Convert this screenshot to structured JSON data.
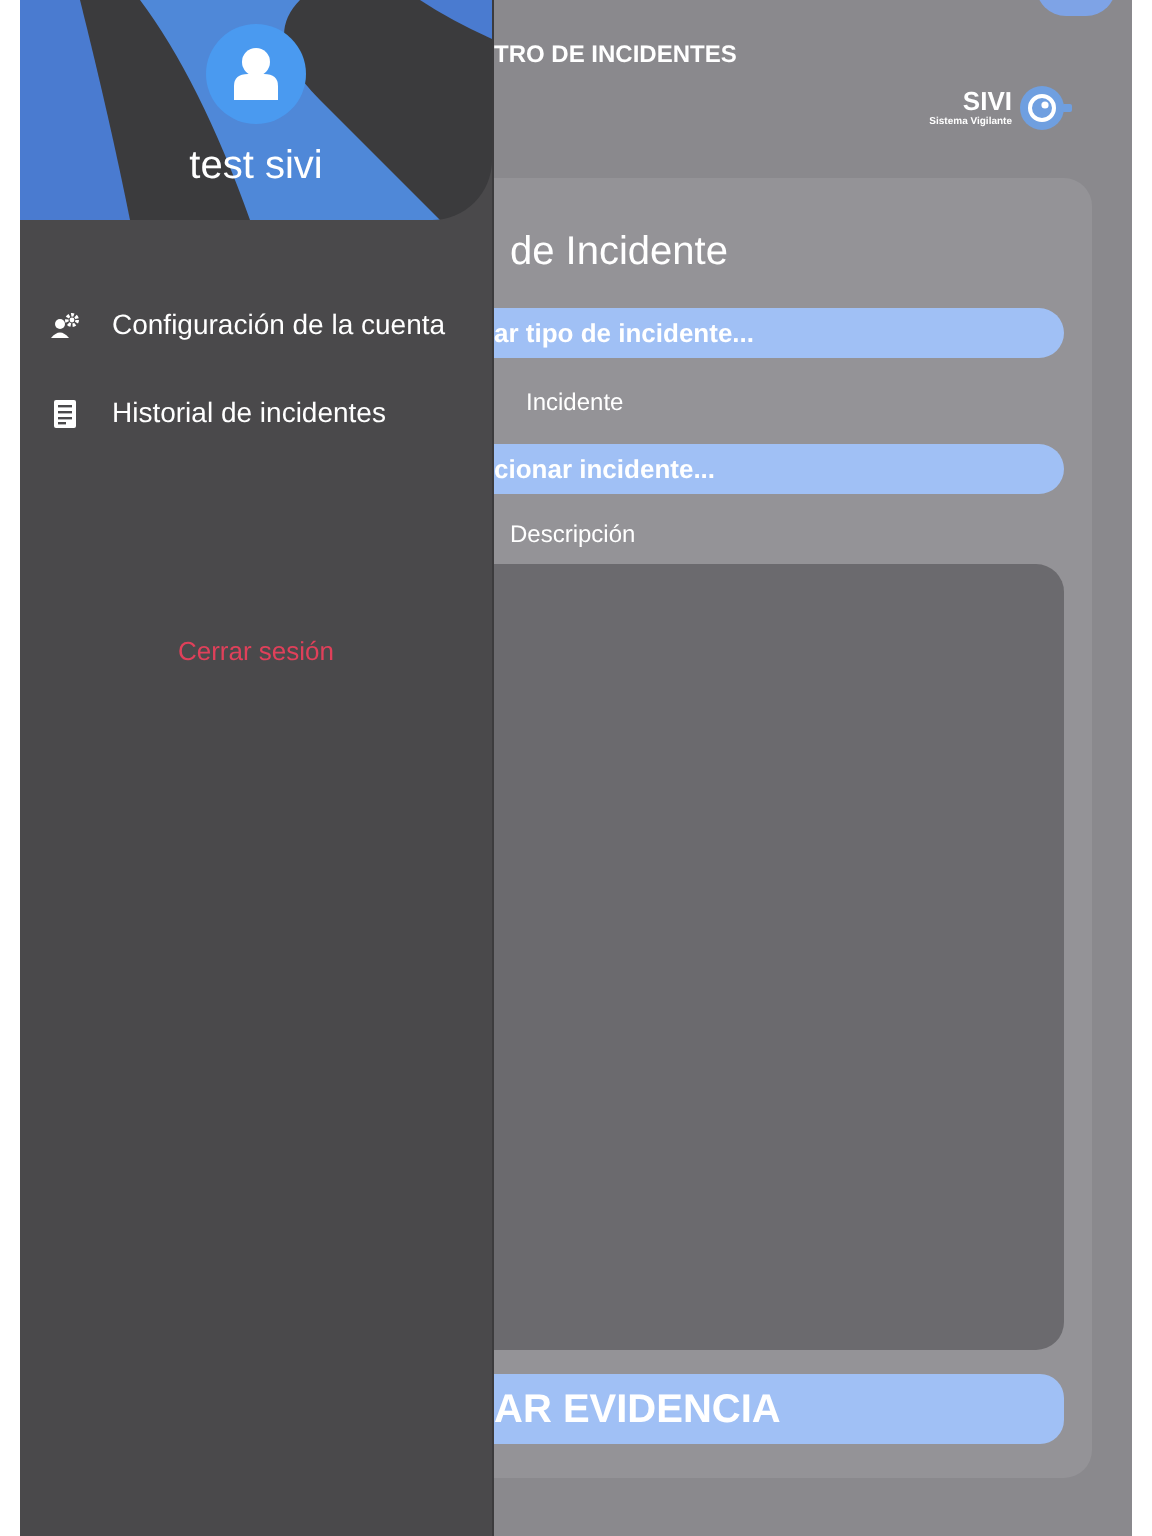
{
  "drawer": {
    "user_name": "test sivi",
    "menu": [
      {
        "label": "Configuración de la cuenta",
        "kind": "settings"
      },
      {
        "label": "Historial de incidentes",
        "kind": "history"
      }
    ],
    "logout": "Cerrar sesión"
  },
  "header": {
    "title": "TRO DE INCIDENTES",
    "logo": {
      "name": "SIVI",
      "tagline": "Sistema Vigilante"
    }
  },
  "form": {
    "title": "de Incidente",
    "type_select": "ar tipo de incidente...",
    "incident_label": "Incidente",
    "incident_select": "cionar incidente...",
    "description_label": "Descripción",
    "submit": "AR EVIDENCIA"
  }
}
